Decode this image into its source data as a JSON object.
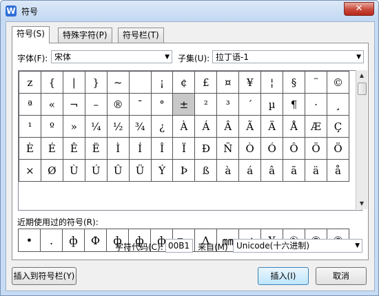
{
  "window": {
    "title": "符号",
    "app_icon": "W",
    "close_glyph": "✕"
  },
  "tabs": [
    {
      "label": "符号(S)",
      "active": true
    },
    {
      "label": "特殊字符(P)",
      "active": false
    },
    {
      "label": "符号栏(T)",
      "active": false
    }
  ],
  "font": {
    "label": "字体(F):",
    "value": "宋体"
  },
  "subset": {
    "label": "子集(U):",
    "value": "拉丁语-1"
  },
  "symbol_grid": [
    [
      "z",
      "{",
      "|",
      "}",
      "~",
      "",
      "¡",
      "¢",
      "£",
      "¤",
      "¥",
      "¦",
      "§",
      "¨",
      "©"
    ],
    [
      "ª",
      "«",
      "¬",
      "–",
      "®",
      "¯",
      "°",
      "±",
      "²",
      "³",
      "´",
      "µ",
      "¶",
      "·",
      "¸"
    ],
    [
      "¹",
      "º",
      "»",
      "¼",
      "½",
      "¾",
      "¿",
      "À",
      "Á",
      "Â",
      "Ã",
      "Ä",
      "Å",
      "Æ",
      "Ç"
    ],
    [
      "È",
      "É",
      "Ê",
      "Ë",
      "Ì",
      "Í",
      "Î",
      "Ï",
      "Ð",
      "Ñ",
      "Ò",
      "Ó",
      "Ô",
      "Õ",
      "Ö"
    ],
    [
      "×",
      "Ø",
      "Ù",
      "Ú",
      "Û",
      "Ü",
      "Ý",
      "Þ",
      "ß",
      "à",
      "á",
      "â",
      "ã",
      "ä",
      "å"
    ]
  ],
  "selected_symbol": "±",
  "recent": {
    "label": "近期使用过的符号(R):",
    "symbols": [
      "•",
      ".",
      "ф",
      "Ф",
      "ф",
      "ф",
      "ф",
      "℡",
      "Δ",
      "㎜",
      "≠",
      "¥",
      "①",
      "②",
      "③"
    ]
  },
  "char_code": {
    "label": "字符代码(C):",
    "value": "00B1"
  },
  "from": {
    "label": "来自(M)",
    "value": "Unicode(十六进制)"
  },
  "buttons": {
    "insert_to_bar": "插入到符号栏(Y)",
    "insert": "插入(I)",
    "cancel": "取消"
  }
}
